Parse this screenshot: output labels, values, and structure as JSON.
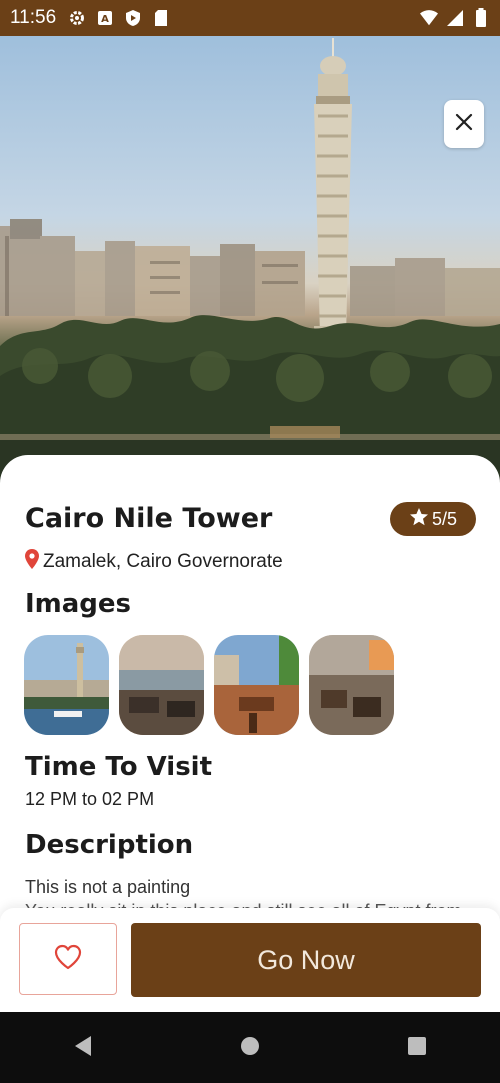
{
  "status_bar": {
    "time": "11:56",
    "left_icons": [
      "gear-icon",
      "a-icon",
      "shield-icon",
      "sdcard-icon"
    ],
    "right_icons": [
      "wifi-icon",
      "signal-icon",
      "battery-icon"
    ]
  },
  "colors": {
    "brand": "#6b4017",
    "heart": "#e0453a",
    "pin": "#e0453a"
  },
  "place": {
    "name": "Cairo Nile Tower",
    "rating": "5/5",
    "location": "Zamalek, Cairo Governorate"
  },
  "sections": {
    "images_title": "Images",
    "visit_title": "Time To Visit",
    "visit_time": "12 PM to 02 PM",
    "description_title": "Description",
    "description_line1": "This is not a painting",
    "description_line2": "You really sit in this place and still see all of Egypt from"
  },
  "images": [
    "tower-photo",
    "terrace-photo-1",
    "terrace-photo-2",
    "terrace-photo-3"
  ],
  "actions": {
    "go_label": "Go Now"
  },
  "nav": [
    "back-icon",
    "home-icon",
    "recents-icon"
  ]
}
